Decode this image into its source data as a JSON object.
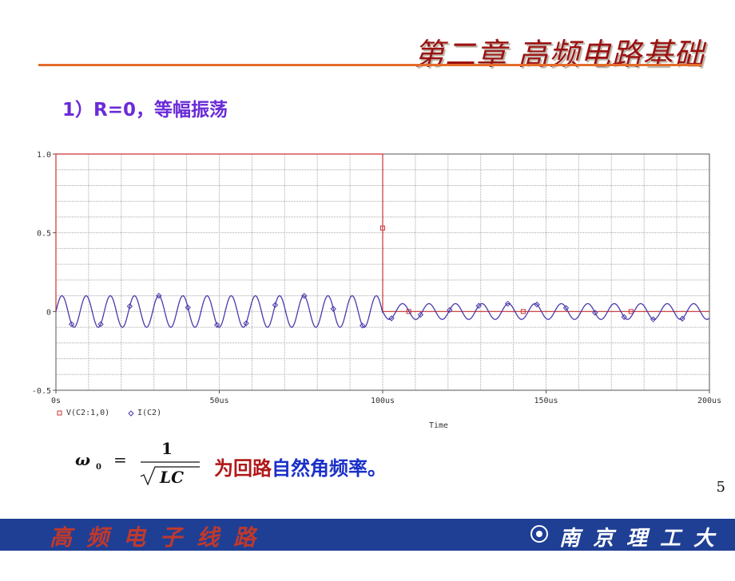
{
  "slide": {
    "title": "第二章 高频电路基础",
    "subtitle": "1）R=0，等幅振荡",
    "formula_text_part1": "为回路",
    "formula_text_part2": "自然角频率。",
    "page_number": "5",
    "footer_left": "高频电子线路",
    "footer_right": "南京理工大学",
    "colors": {
      "title": "#9b1111",
      "rule": "#e46c2a",
      "footer_bg": "#1f3f95",
      "accent_red": "#b01818",
      "accent_blue": "#1a30c8",
      "curve": "#4a3aaa",
      "voltage": "#cc3333"
    }
  },
  "formula": {
    "lhs": "ω",
    "subscript": "0",
    "equals": "=",
    "numerator": "1",
    "denominator": "LC"
  },
  "chart_data": {
    "type": "line",
    "x_label": "Time",
    "x_unit": "us",
    "xlim": [
      0,
      200
    ],
    "ylim": [
      -0.5,
      1.0
    ],
    "y_ticks": [
      "1.0",
      "0.5",
      "0",
      "-0.5"
    ],
    "x_ticks": [
      "0s",
      "50us",
      "100us",
      "150us",
      "200us"
    ],
    "grid": true,
    "legend": [
      {
        "name": "V(C2:1,0)",
        "marker": "square",
        "color": "#cc3333"
      },
      {
        "name": "I(C2)",
        "marker": "diamond",
        "color": "#4a3aaa"
      }
    ],
    "series": [
      {
        "name": "V(C2:1,0)",
        "color": "#cc3333",
        "points": [
          [
            0,
            0
          ],
          [
            0,
            1.0
          ],
          [
            100,
            1.0
          ],
          [
            100,
            0
          ],
          [
            200,
            0
          ]
        ],
        "marker_points": [
          [
            100,
            0.53
          ],
          [
            108,
            0
          ],
          [
            143,
            0
          ],
          [
            176,
            0
          ]
        ]
      },
      {
        "name": "I(C2)",
        "color": "#4a3aaa",
        "segments": [
          {
            "x_start": 0,
            "x_end": 100,
            "amplitude": 0.1,
            "period": 7.4
          },
          {
            "x_start": 100,
            "x_end": 200,
            "amplitude": 0.05,
            "period": 8.1
          }
        ]
      }
    ]
  }
}
